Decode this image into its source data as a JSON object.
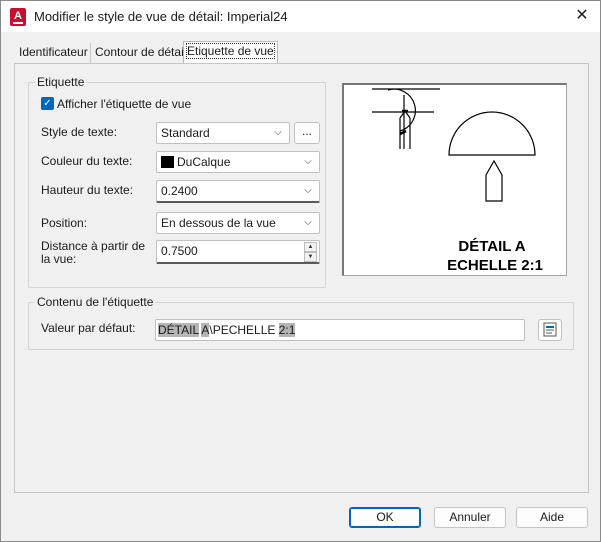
{
  "window": {
    "title": "Modifier le style de vue de détail: Imperial24",
    "app_icon_letter": "A",
    "close_glyph": "✕"
  },
  "tabs": [
    {
      "label": "Identificateur",
      "active": false
    },
    {
      "label": "Contour de détail",
      "active": false
    },
    {
      "label": "Etiquette de vue",
      "active": true
    }
  ],
  "etiquette": {
    "group_title": "Etiquette",
    "show_label": {
      "label": "Afficher l'étiquette de vue",
      "checked": true
    },
    "text_style": {
      "label": "Style de texte:",
      "value": "Standard",
      "browse_label": "..."
    },
    "text_color": {
      "label": "Couleur du texte:",
      "value": "DuCalque",
      "swatch_color": "#000000"
    },
    "text_height": {
      "label": "Hauteur du texte:",
      "value": "0.2400"
    },
    "position": {
      "label": "Position:",
      "value": "En dessous de la vue"
    },
    "distance": {
      "label": "Distance à partir de la vue:",
      "value": "0.7500"
    }
  },
  "preview": {
    "line1": "DÉTAIL A",
    "line2": "ECHELLE 2:1"
  },
  "contenu": {
    "group_title": "Contenu de l'étiquette",
    "default_label": "Valeur par défaut:",
    "value_parts": [
      "DÉTAIL",
      " ",
      "A",
      "\\PECHELLE ",
      "2:1"
    ]
  },
  "buttons": {
    "ok": "OK",
    "cancel": "Annuler",
    "help": "Aide"
  },
  "colors": {
    "accent": "#0067c0",
    "autocad_red": "#c8102e",
    "field_highlight": "#b5b5b5"
  }
}
